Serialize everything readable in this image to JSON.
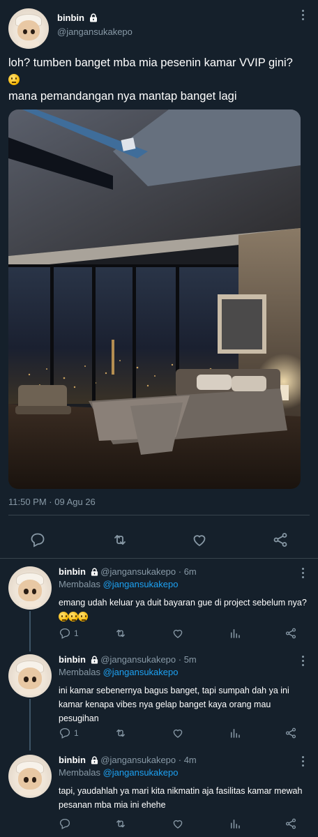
{
  "tweet": {
    "display_name": "binbin",
    "username": "@jangansukakepo",
    "text_line1": "loh? tumben banget mba mia pesenin kamar VVIP gini?",
    "text_line2": "mana pemandangan nya mantap banget lagi",
    "timestamp": "11:50 PM · 09 Agu 26"
  },
  "replies": [
    {
      "display_name": "binbin",
      "username": "@jangansukakepo",
      "time": "· 6m",
      "replying_to_label": "Membalas",
      "replying_to": "@jangansukakepo",
      "text": "emang udah keluar ya duit bayaran gue di project sebelum nya?",
      "reply_count": "1"
    },
    {
      "display_name": "binbin",
      "username": "@jangansukakepo",
      "time": "· 5m",
      "replying_to_label": "Membalas",
      "replying_to": "@jangansukakepo",
      "text": "ini kamar sebenernya bagus banget, tapi sumpah dah ya ini kamar kenapa vibes nya gelap banget kaya orang mau pesugihan",
      "reply_count": "1"
    },
    {
      "display_name": "binbin",
      "username": "@jangansukakepo",
      "time": "· 4m",
      "replying_to_label": "Membalas",
      "replying_to": "@jangansukakepo",
      "text": "tapi, yaudahlah ya mari kita nikmatin aja fasilitas kamar mewah pesanan mba mia ini ehehe",
      "reply_count": ""
    }
  ],
  "icons": [
    "lock-icon",
    "more-icon",
    "reply-icon",
    "retweet-icon",
    "like-icon",
    "share-icon",
    "analytics-icon",
    "thinking-emoji"
  ],
  "colors": {
    "background": "#15202b",
    "secondary_text": "#8899a6",
    "accent": "#1da1f2",
    "divider": "#38444d"
  }
}
